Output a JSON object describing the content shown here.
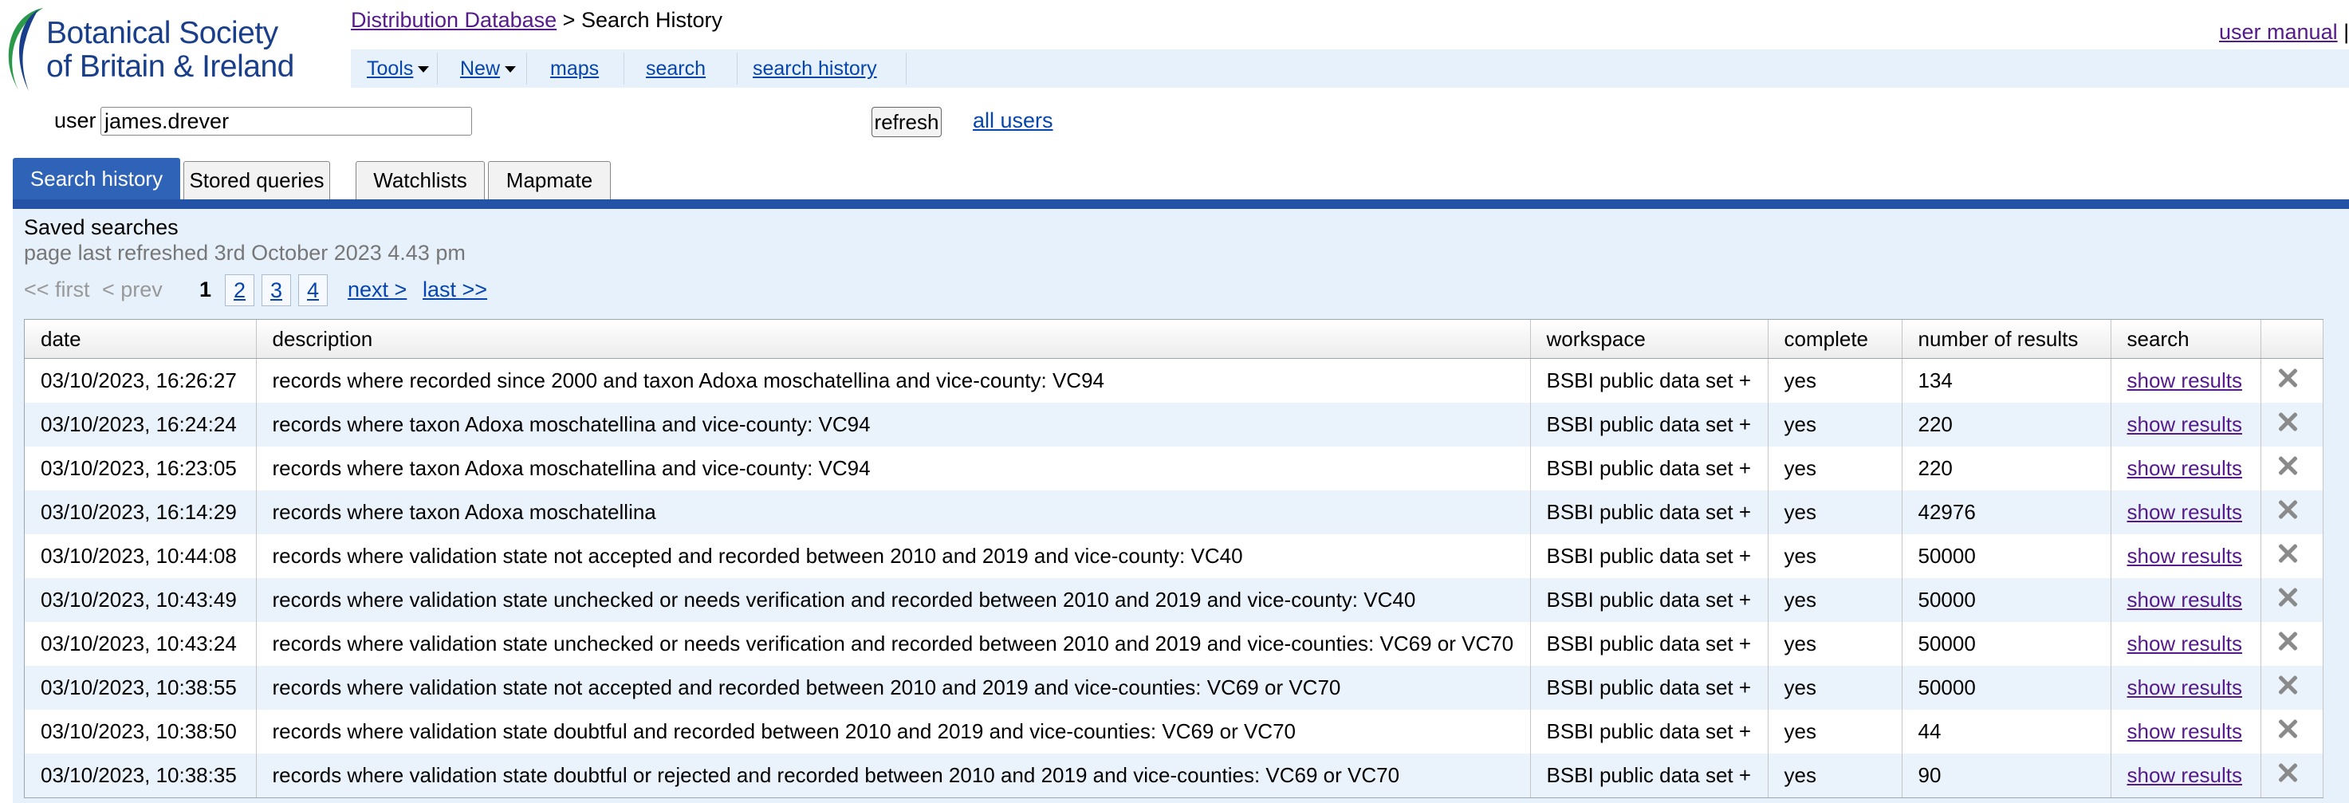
{
  "logo": {
    "line1": "Botanical Society",
    "line2": "of Britain & Ireland"
  },
  "breadcrumb": {
    "root": "Distribution Database",
    "separator": ">",
    "current": "Search History"
  },
  "header": {
    "user_manual": "user manual",
    "trailing": "|"
  },
  "nav": {
    "tools": "Tools",
    "new": "New",
    "maps": "maps",
    "search": "search",
    "search_history": "search history"
  },
  "user": {
    "label": "user",
    "value": "james.drever",
    "refresh": "refresh",
    "all_users": "all users"
  },
  "tabs": [
    "Search history",
    "Stored queries",
    "Watchlists",
    "Mapmate"
  ],
  "panel": {
    "title": "Saved searches",
    "refreshed": "page last refreshed 3rd October 2023 4.43 pm"
  },
  "pager": {
    "first": "<< first",
    "prev": "< prev",
    "pages": [
      "1",
      "2",
      "3",
      "4"
    ],
    "next": "next >",
    "last": "last >>"
  },
  "table": {
    "columns": [
      "date",
      "description",
      "workspace",
      "complete",
      "number of results",
      "search"
    ],
    "rows": [
      {
        "date": "03/10/2023, 16:26:27",
        "description": "records where recorded since 2000 and taxon Adoxa moschatellina and vice-county: VC94",
        "workspace": "BSBI public data set +",
        "complete": "yes",
        "results": "134",
        "action": "show results"
      },
      {
        "date": "03/10/2023, 16:24:24",
        "description": "records where taxon Adoxa moschatellina and vice-county: VC94",
        "workspace": "BSBI public data set +",
        "complete": "yes",
        "results": "220",
        "action": "show results"
      },
      {
        "date": "03/10/2023, 16:23:05",
        "description": "records where taxon Adoxa moschatellina and vice-county: VC94",
        "workspace": "BSBI public data set +",
        "complete": "yes",
        "results": "220",
        "action": "show results"
      },
      {
        "date": "03/10/2023, 16:14:29",
        "description": "records where taxon Adoxa moschatellina",
        "workspace": "BSBI public data set +",
        "complete": "yes",
        "results": "42976",
        "action": "show results"
      },
      {
        "date": "03/10/2023, 10:44:08",
        "description": "records where validation state not accepted and recorded between 2010 and 2019 and vice-county: VC40",
        "workspace": "BSBI public data set +",
        "complete": "yes",
        "results": "50000",
        "action": "show results"
      },
      {
        "date": "03/10/2023, 10:43:49",
        "description": "records where validation state unchecked or needs verification and recorded between 2010 and 2019 and vice-county: VC40",
        "workspace": "BSBI public data set +",
        "complete": "yes",
        "results": "50000",
        "action": "show results"
      },
      {
        "date": "03/10/2023, 10:43:24",
        "description": "records where validation state unchecked or needs verification and recorded between 2010 and 2019 and vice-counties: VC69 or VC70",
        "workspace": "BSBI public data set +",
        "complete": "yes",
        "results": "50000",
        "action": "show results"
      },
      {
        "date": "03/10/2023, 10:38:55",
        "description": "records where validation state not accepted and recorded between 2010 and 2019 and vice-counties: VC69 or VC70",
        "workspace": "BSBI public data set +",
        "complete": "yes",
        "results": "50000",
        "action": "show results"
      },
      {
        "date": "03/10/2023, 10:38:50",
        "description": "records where validation state doubtful and recorded between 2010 and 2019 and vice-counties: VC69 or VC70",
        "workspace": "BSBI public data set +",
        "complete": "yes",
        "results": "44",
        "action": "show results"
      },
      {
        "date": "03/10/2023, 10:38:35",
        "description": "records where validation state doubtful or rejected and recorded between 2010 and 2019 and vice-counties: VC69 or VC70",
        "workspace": "BSBI public data set +",
        "complete": "yes",
        "results": "90",
        "action": "show results"
      }
    ]
  }
}
